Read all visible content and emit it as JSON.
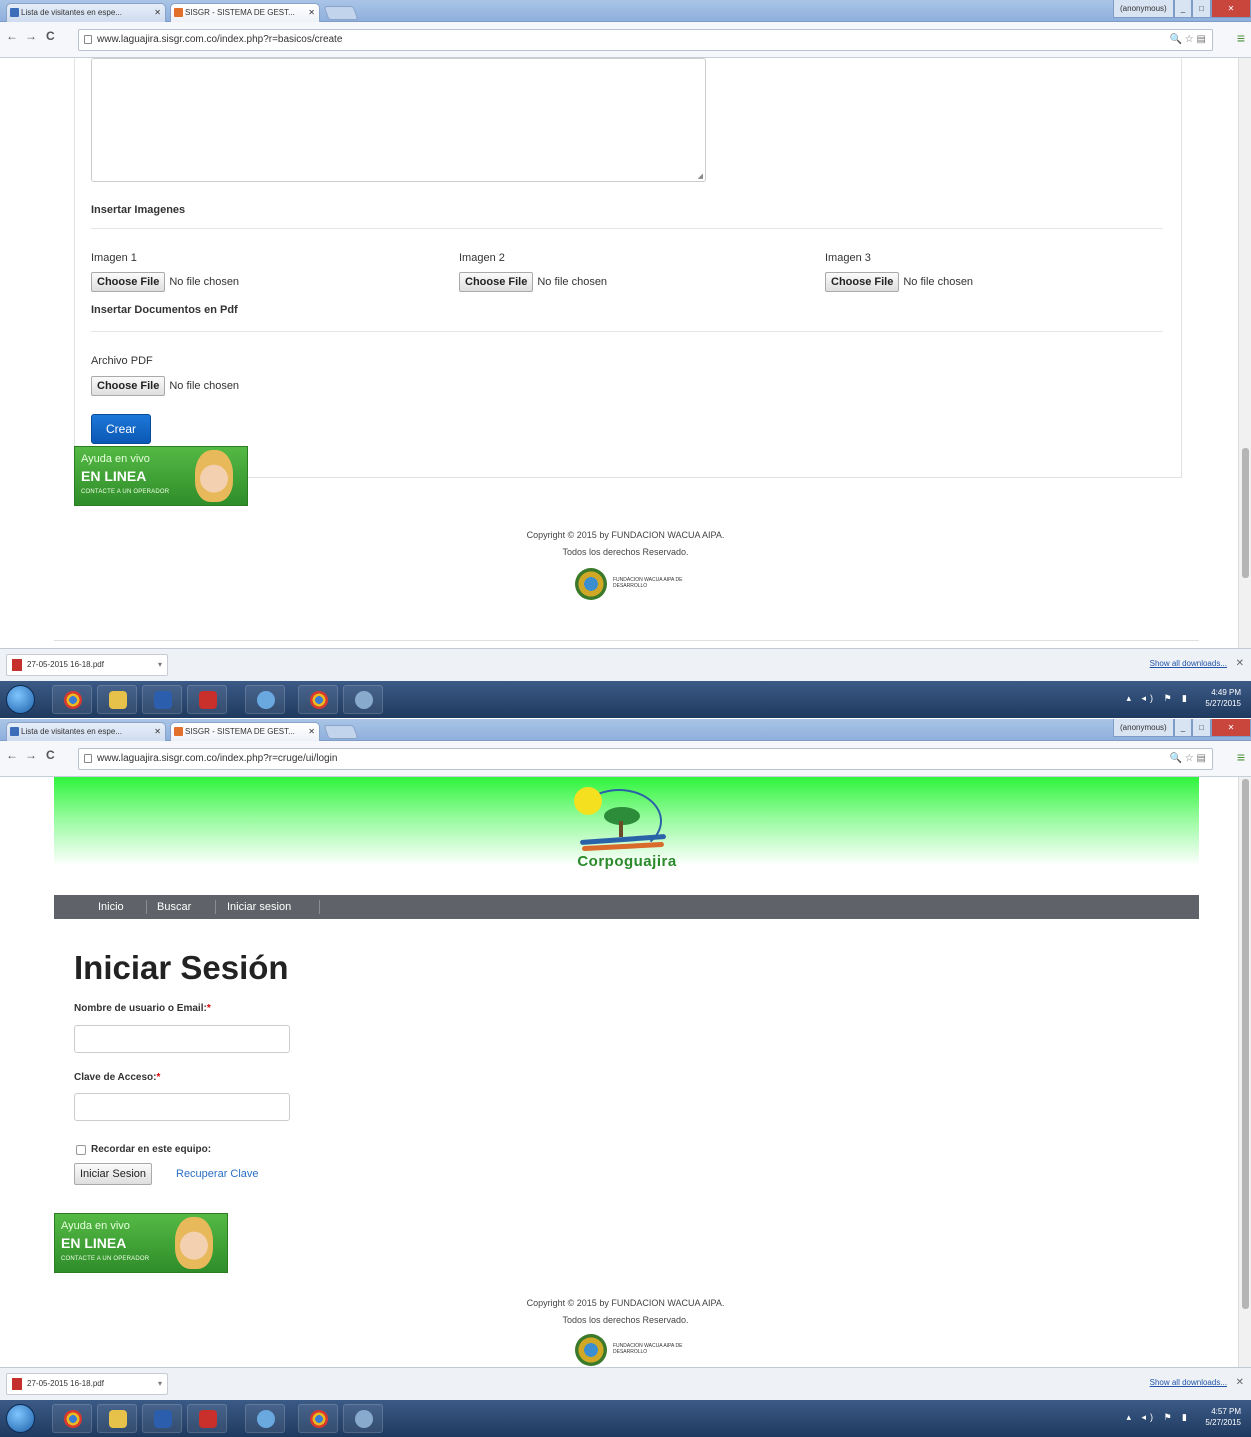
{
  "browser": {
    "tabs": [
      {
        "label": "Lista de visitantes en espe..."
      },
      {
        "label": "SISGR - SISTEMA DE GEST..."
      }
    ],
    "window_controls": {
      "user": "(anonymous)",
      "min": "_",
      "max": "□",
      "close": "✕"
    }
  },
  "screen1": {
    "url": "www.laguajira.sisgr.com.co/index.php?r=basicos/create",
    "images_section_title": "Insertar Imagenes",
    "images": [
      {
        "label": "Imagen 1",
        "button": "Choose File",
        "status": "No file chosen"
      },
      {
        "label": "Imagen 2",
        "button": "Choose File",
        "status": "No file chosen"
      },
      {
        "label": "Imagen 3",
        "button": "Choose File",
        "status": "No file chosen"
      }
    ],
    "pdf_section_title": "Insertar Documentos en Pdf",
    "pdf_label": "Archivo PDF",
    "pdf_button": "Choose File",
    "pdf_status": "No file chosen",
    "submit_label": "Crear",
    "scroll_position": 0.85,
    "clock": {
      "time": "4:49 PM",
      "date": "5/27/2015"
    }
  },
  "screen2": {
    "url": "www.laguajira.sisgr.com.co/index.php?r=cruge/ui/login",
    "brand": "Corpoguajira",
    "nav": [
      "Inicio",
      "Buscar",
      "Iniciar sesion"
    ],
    "title": "Iniciar Sesión",
    "username_label": "Nombre de usuario o Email:",
    "password_label": "Clave de Acceso:",
    "required_mark": "*",
    "remember_label": "Recordar en este equipo:",
    "login_button": "Iniciar Sesion",
    "recover_link": "Recuperar Clave",
    "scroll_position": 0.0,
    "clock": {
      "time": "4:57 PM",
      "date": "5/27/2015"
    }
  },
  "help_banner": {
    "line1": "Ayuda en vivo",
    "line2": "EN LINEA",
    "line3": "CONTACTE A UN OPERADOR"
  },
  "footer": {
    "copyright": "Copyright © 2015 by FUNDACION WACUA AIPA.",
    "rights": "Todos los derechos Reservado.",
    "logo_text": "FUNDACION WACUA AIPA DE DESARROLLO"
  },
  "downloads": {
    "file": "27-05-2015 16-18.pdf",
    "show_all": "Show all downloads..."
  },
  "taskbar_icons": [
    "start-orb",
    "chrome",
    "explorer",
    "word",
    "acrobat",
    "magnifier",
    "chrome-2",
    "paint"
  ]
}
